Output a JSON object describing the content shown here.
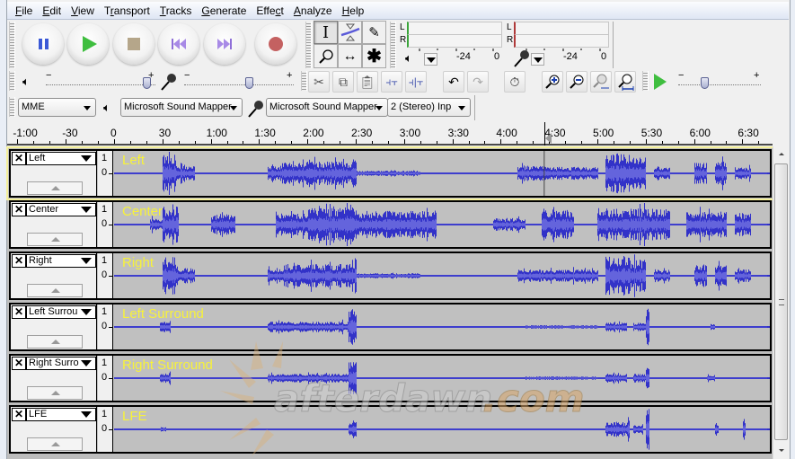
{
  "menu": [
    {
      "label": "File",
      "accel": "F"
    },
    {
      "label": "Edit",
      "accel": "E"
    },
    {
      "label": "View",
      "accel": "V"
    },
    {
      "label": "Transport",
      "accel": "r"
    },
    {
      "label": "Tracks",
      "accel": "T"
    },
    {
      "label": "Generate",
      "accel": "G"
    },
    {
      "label": "Effect",
      "accel": "c"
    },
    {
      "label": "Analyze",
      "accel": "A"
    },
    {
      "label": "Help",
      "accel": "H"
    }
  ],
  "transport": {
    "buttons": [
      "pause",
      "play",
      "stop",
      "skip-to-start",
      "skip-to-end",
      "record"
    ]
  },
  "tools": {
    "items": [
      "selection-tool",
      "envelope-tool",
      "draw-tool",
      "zoom-tool",
      "timeshift-tool",
      "multi-tool"
    ],
    "active": "selection-tool"
  },
  "meters": {
    "playback": {
      "channels": [
        "L",
        "R"
      ],
      "scale": [
        "-24",
        "0"
      ]
    },
    "record": {
      "channels": [
        "L",
        "R"
      ],
      "scale": [
        "-24",
        "0"
      ]
    },
    "colors": {
      "playback": "#3aa53a",
      "record": "#b03a3a"
    }
  },
  "mixer": {
    "output_volume_fraction": 0.93,
    "input_volume_fraction": 0.6,
    "minus": "−",
    "plus": "+"
  },
  "play_at_speed": {
    "fraction": 0.33,
    "minus": "−",
    "plus": "+"
  },
  "devices": {
    "host": "MME",
    "output": "Microsoft Sound Mapper",
    "input": "Microsoft Sound Mapper",
    "channels": "2 (Stereo) Inp"
  },
  "ruler": {
    "labels": [
      "-1:00",
      "-30",
      "0",
      "30",
      "1:00",
      "1:30",
      "2:00",
      "2:30",
      "3:00",
      "3:30",
      "4:00",
      "4:30",
      "5:00",
      "5:30",
      "6:00",
      "6:30"
    ],
    "label_seconds": [
      -60,
      -30,
      0,
      30,
      60,
      90,
      120,
      150,
      180,
      210,
      240,
      270,
      300,
      330,
      360,
      390
    ],
    "cursor_seconds": 267
  },
  "tracks": [
    {
      "name": "Left",
      "label": "Left",
      "selected": true,
      "scale_top": "1",
      "scale_mid": "0-",
      "profile": [
        [
          30,
          38,
          0.9
        ],
        [
          38,
          50,
          0.35
        ],
        [
          95,
          105,
          0.35
        ],
        [
          105,
          150,
          0.55
        ],
        [
          149,
          150,
          1.0
        ],
        [
          150,
          190,
          0.12
        ],
        [
          250,
          270,
          0.35
        ],
        [
          270,
          300,
          0.3
        ],
        [
          305,
          320,
          0.95
        ],
        [
          320,
          330,
          0.75
        ],
        [
          335,
          345,
          0.3
        ],
        [
          360,
          368,
          0.5
        ],
        [
          373,
          380,
          0.6
        ],
        [
          385,
          395,
          0.3
        ]
      ]
    },
    {
      "name": "Center",
      "label": "Center",
      "selected": false,
      "scale_top": "1",
      "scale_mid": "0-",
      "profile": [
        [
          22,
          30,
          0.3
        ],
        [
          30,
          40,
          0.85
        ],
        [
          60,
          75,
          0.5
        ],
        [
          100,
          120,
          0.55
        ],
        [
          120,
          150,
          0.8
        ],
        [
          150,
          200,
          0.65
        ],
        [
          235,
          255,
          0.3
        ],
        [
          265,
          285,
          0.7
        ],
        [
          300,
          345,
          0.75
        ],
        [
          355,
          380,
          0.6
        ],
        [
          385,
          395,
          0.55
        ]
      ]
    },
    {
      "name": "Right",
      "label": "Right",
      "selected": false,
      "scale_top": "1",
      "scale_mid": "0-",
      "profile": [
        [
          30,
          38,
          0.9
        ],
        [
          38,
          50,
          0.35
        ],
        [
          95,
          105,
          0.35
        ],
        [
          105,
          150,
          0.55
        ],
        [
          149,
          150,
          1.0
        ],
        [
          150,
          190,
          0.12
        ],
        [
          250,
          270,
          0.3
        ],
        [
          270,
          300,
          0.3
        ],
        [
          305,
          320,
          0.95
        ],
        [
          320,
          330,
          0.75
        ],
        [
          335,
          345,
          0.3
        ],
        [
          360,
          368,
          0.5
        ],
        [
          373,
          380,
          0.6
        ],
        [
          385,
          395,
          0.3
        ]
      ]
    },
    {
      "name": "Left Surrou",
      "label": "Left Surround",
      "selected": false,
      "scale_top": "1",
      "scale_mid": "0-",
      "profile": [
        [
          28,
          35,
          0.3
        ],
        [
          95,
          150,
          0.25
        ],
        [
          145,
          150,
          0.85
        ],
        [
          255,
          300,
          0.08
        ],
        [
          305,
          318,
          0.2
        ],
        [
          322,
          330,
          0.2
        ],
        [
          330,
          332,
          0.9
        ],
        [
          370,
          373,
          0.15
        ]
      ]
    },
    {
      "name": "Right Surro",
      "label": "Right Surround",
      "selected": false,
      "scale_top": "1",
      "scale_mid": "0-",
      "profile": [
        [
          28,
          35,
          0.25
        ],
        [
          95,
          150,
          0.2
        ],
        [
          145,
          150,
          0.75
        ],
        [
          255,
          300,
          0.08
        ],
        [
          305,
          318,
          0.2
        ],
        [
          322,
          330,
          0.2
        ],
        [
          330,
          332,
          0.8
        ],
        [
          368,
          373,
          0.15
        ]
      ]
    },
    {
      "name": "LFE",
      "label": "LFE",
      "selected": false,
      "scale_top": "1",
      "scale_mid": "0-",
      "profile": [
        [
          28,
          32,
          0.1
        ],
        [
          145,
          150,
          0.35
        ],
        [
          305,
          318,
          0.35
        ],
        [
          318,
          320,
          0.6
        ],
        [
          322,
          328,
          0.2
        ],
        [
          330,
          332,
          1.0
        ],
        [
          373,
          375,
          0.3
        ],
        [
          390,
          392,
          0.5
        ]
      ]
    }
  ],
  "waveform_colors": {
    "peak": "#3232c8",
    "rms": "#6464dc",
    "background": "#c0c0c0",
    "label": "#f7f23a"
  },
  "watermark": {
    "text_a": "afterdawn",
    "text_b": ".com"
  }
}
